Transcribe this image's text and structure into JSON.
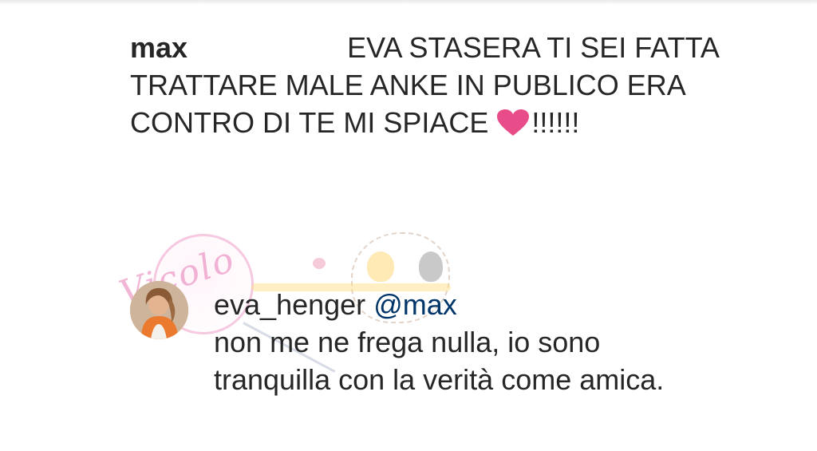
{
  "main_comment": {
    "username": "max",
    "text": "                    EVA STASERA TI SEI FATTA TRATTARE MALE ANKE IN PUBLICO ERA CONTRO DI TE MI SPIACE ",
    "emoji": "heart-icon",
    "trailing": "!!!!!!"
  },
  "reply": {
    "username": "eva_henger",
    "mention": "@max",
    "text": "non me ne frega nulla, io sono tranquilla con la verità come amica.",
    "avatar": "avatar"
  },
  "watermark": {
    "logo": "Vicolo delle News watermark"
  },
  "colors": {
    "text": "#262626",
    "mention": "#003569",
    "heart": "#e84d8a"
  }
}
